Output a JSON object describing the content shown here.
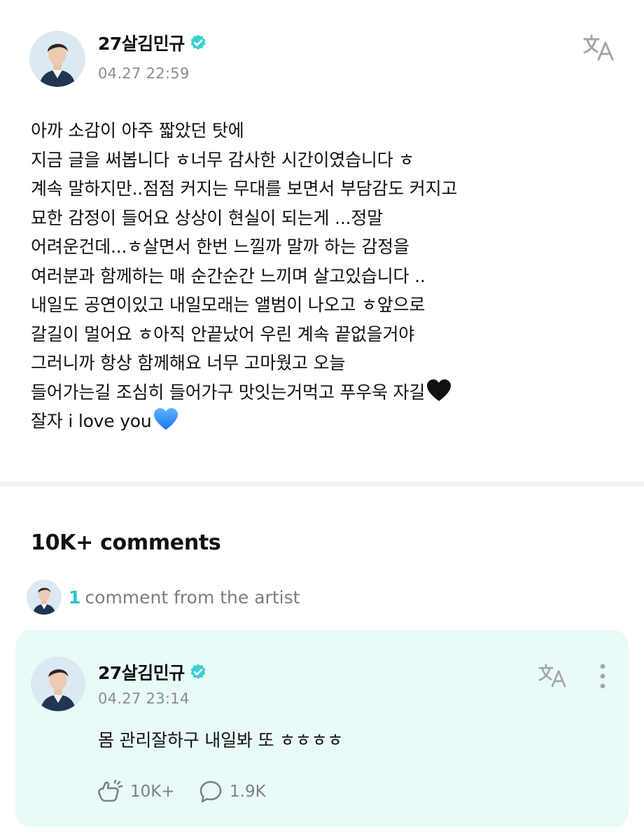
{
  "post": {
    "author": "27살김민규",
    "timestamp": "04.27 22:59",
    "lines": [
      "아까 소감이 아주 짧았던 탓에",
      "지금 글을 써봅니다 ㅎ너무 감사한 시간이였습니다 ㅎ",
      "계속 말하지만..점점 커지는 무대를 보면서 부담감도 커지고",
      "묘한 감정이 들어요 상상이 현실이 되는게 ...정말",
      "어려운건데...ㅎ살면서 한번 느낄까 말까 하는 감정을",
      "여러분과 함께하는 매 순간순간 느끼며 살고있습니다 ..",
      "내일도 공연이있고 내일모래는 앨범이 나오고 ㅎ앞으로",
      "갈길이 멀어요 ㅎ아직 안끝났어 우린 계속 끝없을거야",
      "그러니까 항상 함께해요 너무 고마웠고 오늘",
      "들어가는길 조심히 들어가구 맛잇는거먹고 푸우욱 자길",
      "잘자 i love you"
    ],
    "emoji_black_heart": "black-heart-emoji",
    "emoji_blue_heart": "blue-heart-emoji"
  },
  "comments": {
    "count_label": "10K+ comments",
    "artist_count": "1",
    "artist_label": "comment from the artist"
  },
  "artist_comment": {
    "author": "27살김민규",
    "timestamp": "04.27 23:14",
    "text": "몸 관리잘하구 내일봐 또 ㅎㅎㅎㅎ",
    "likes": "10K+",
    "replies": "1.9K"
  },
  "colors": {
    "accent": "#27c2c8",
    "card_background": "#e9fbf8",
    "verified": "#3ccfd0",
    "muted_text": "#8d8d8d"
  },
  "icons": {
    "translate": "translate-icon",
    "more": "more-vertical-icon",
    "like": "like-reaction-icon",
    "reply": "comment-bubble-icon",
    "verified": "verified-badge-icon"
  }
}
